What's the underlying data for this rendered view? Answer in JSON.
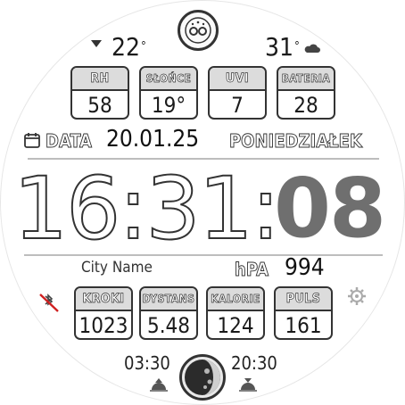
{
  "weather": {
    "temp_low": "22",
    "temp_high": "31",
    "degree_symbol": "°"
  },
  "top_tiles": [
    {
      "label": "RH",
      "value": "58"
    },
    {
      "label": "SŁOŃCE",
      "value": "19°"
    },
    {
      "label": "UVI",
      "value": "7"
    },
    {
      "label": "BATERIA",
      "value": "28"
    }
  ],
  "date": {
    "label": "DATA",
    "value": "20.01.25",
    "weekday": "PONIEDZIAŁEK"
  },
  "time": {
    "hours": "16",
    "minutes": "31",
    "separator": ":",
    "seconds": "08"
  },
  "location": {
    "city": "City Name",
    "pressure_label": "hPA",
    "pressure_value": "994"
  },
  "bottom_tiles": [
    {
      "label": "KROKI",
      "value": "1023"
    },
    {
      "label": "DYSTANS",
      "value": "5.48"
    },
    {
      "label": "KALORIE",
      "value": "124"
    },
    {
      "label": "PULS",
      "value": "161"
    }
  ],
  "sun": {
    "sunrise": "03:30",
    "sunset": "20:30"
  },
  "colors": {
    "seconds": "#6f6f6f",
    "outline": "#333333",
    "tile_label_bg": "#dcdcdc",
    "bt_off": "#d02020"
  }
}
